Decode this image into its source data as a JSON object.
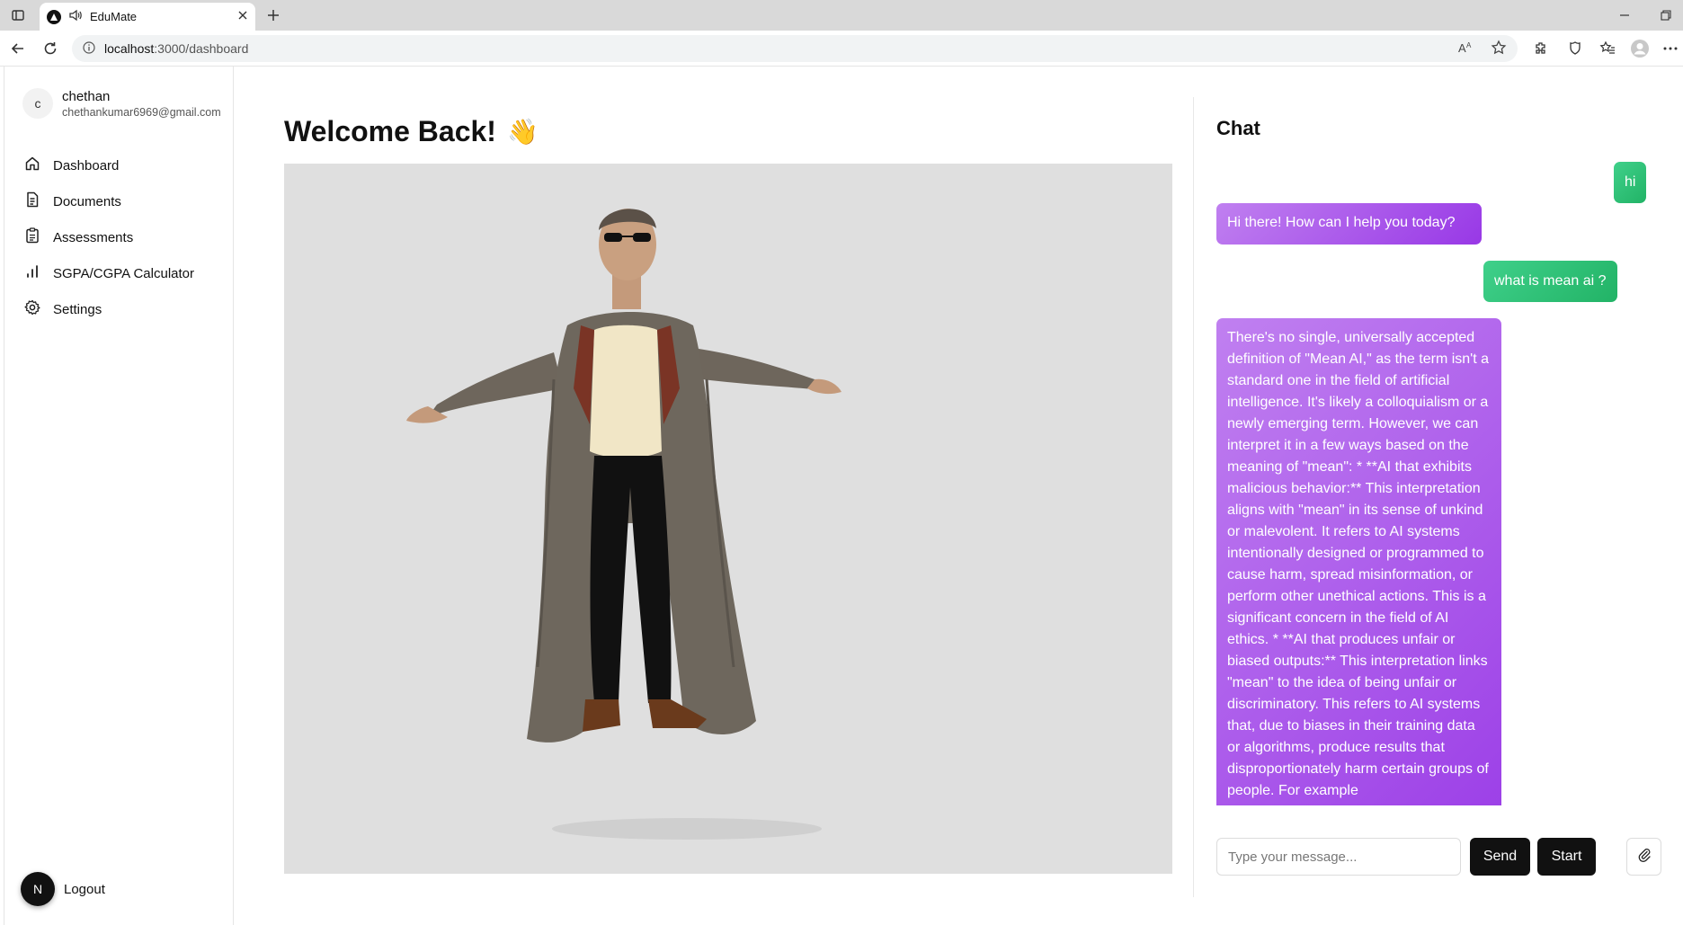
{
  "browser": {
    "tab_title": "EduMate",
    "url_host": "localhost",
    "url_path": ":3000/dashboard"
  },
  "sidebar": {
    "avatar_initial": "c",
    "user_name": "chethan",
    "user_email": "chethankumar6969@gmail.com",
    "items": [
      {
        "label": "Dashboard",
        "icon": "home-icon"
      },
      {
        "label": "Documents",
        "icon": "document-icon"
      },
      {
        "label": "Assessments",
        "icon": "clipboard-icon"
      },
      {
        "label": "SGPA/CGPA Calculator",
        "icon": "bar-chart-icon"
      },
      {
        "label": "Settings",
        "icon": "gear-icon"
      }
    ],
    "logout_badge": "N",
    "logout_label": "Logout"
  },
  "main": {
    "title": "Welcome Back!",
    "title_emoji": "👋"
  },
  "chat": {
    "title": "Chat",
    "messages": [
      {
        "role": "user",
        "text": "hi"
      },
      {
        "role": "bot",
        "text": "Hi there! How can I help you today?"
      },
      {
        "role": "user",
        "text": "what is mean ai ?"
      },
      {
        "role": "bot",
        "text": "There's no single, universally accepted definition of \"Mean AI,\" as the term isn't a standard one in the field of artificial intelligence. It's likely a colloquialism or a newly emerging term. However, we can interpret it in a few ways based on the meaning of \"mean\": * **AI that exhibits malicious behavior:** This interpretation aligns with \"mean\" in its sense of unkind or malevolent. It refers to AI systems intentionally designed or programmed to cause harm, spread misinformation, or perform other unethical actions. This is a significant concern in the field of AI ethics. * **AI that produces unfair or biased outputs:** This interpretation links \"mean\" to the idea of being unfair or discriminatory. This refers to AI systems that, due to biases in their training data or algorithms, produce results that disproportionately harm certain groups of people. For example"
      }
    ],
    "input_placeholder": "Type your message...",
    "send_label": "Send",
    "start_label": "Start"
  },
  "colors": {
    "user_bubble": "#22b366",
    "bot_bubble": "#9838e6",
    "viewer_bg": "#dfdfdf"
  }
}
